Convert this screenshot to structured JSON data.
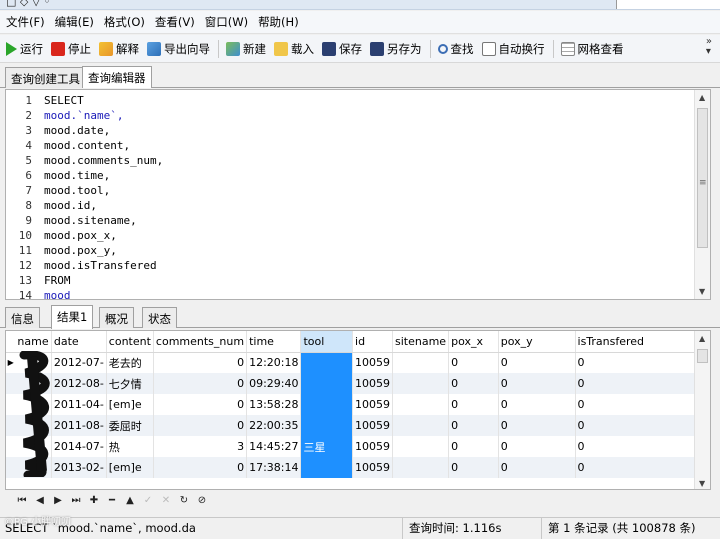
{
  "menu": [
    "文件(F)",
    "编辑(E)",
    "格式(O)",
    "查看(V)",
    "窗口(W)",
    "帮助(H)"
  ],
  "toolbar": {
    "run": "运行",
    "stop": "停止",
    "explain": "解释",
    "export_wizard": "导出向导",
    "new": "新建",
    "load": "载入",
    "save": "保存",
    "save_as": "另存为",
    "find": "查找",
    "word_wrap": "自动换行",
    "grid_view": "网格查看"
  },
  "editor_tabs": [
    "查询创建工具",
    "查询编辑器"
  ],
  "sql_lines": [
    "SELECT",
    "mood.`name`,",
    "mood.date,",
    "mood.content,",
    "mood.comments_num,",
    "mood.time,",
    "mood.tool,",
    "mood.id,",
    "mood.sitename,",
    "mood.pox_x,",
    "mood.pox_y,",
    "mood.isTransfered",
    "FROM",
    "mood"
  ],
  "sql_keyword_lines": [
    1,
    13
  ],
  "result_tabs": [
    "信息",
    "结果1",
    "概况",
    "状态"
  ],
  "columns": [
    "name",
    "date",
    "content",
    "comments_num",
    "time",
    "tool",
    "id",
    "sitename",
    "pox_x",
    "pox_y",
    "isTransfered"
  ],
  "rows": [
    [
      "",
      "2012-07-",
      "老去的",
      "0",
      "12:20:18",
      "",
      "10059",
      "",
      "0",
      "0",
      "0"
    ],
    [
      "",
      "2012-08-",
      "七夕情",
      "0",
      "09:29:40",
      "",
      "10059",
      "",
      "0",
      "0",
      "0"
    ],
    [
      "",
      "2011-04-",
      "[em]e",
      "0",
      "13:58:28",
      "",
      "10059",
      "",
      "0",
      "0",
      "0"
    ],
    [
      "",
      "2011-08-",
      "委屈时",
      "0",
      "22:00:35",
      "",
      "10059",
      "",
      "0",
      "0",
      "0"
    ],
    [
      "",
      "2014-07-",
      "热",
      "3",
      "14:45:27",
      "三星",
      "10059",
      "",
      "0",
      "0",
      "0"
    ],
    [
      "",
      "2013-02-",
      "[em]e",
      "0",
      "17:38:14",
      "",
      "10059",
      "",
      "0",
      "0",
      "0"
    ]
  ],
  "status": {
    "sql": "SELECT `mood.`name`, mood.da",
    "query_time": "查询时间: 1.116s",
    "record": "第 1 条记录 (共 100878 条)"
  },
  "watermark": "©PG 小胖叨叨",
  "colors": {
    "selected_column": "#1e90ff",
    "keyword": "#1a1ab8",
    "alt_row": "#eef2f7"
  }
}
